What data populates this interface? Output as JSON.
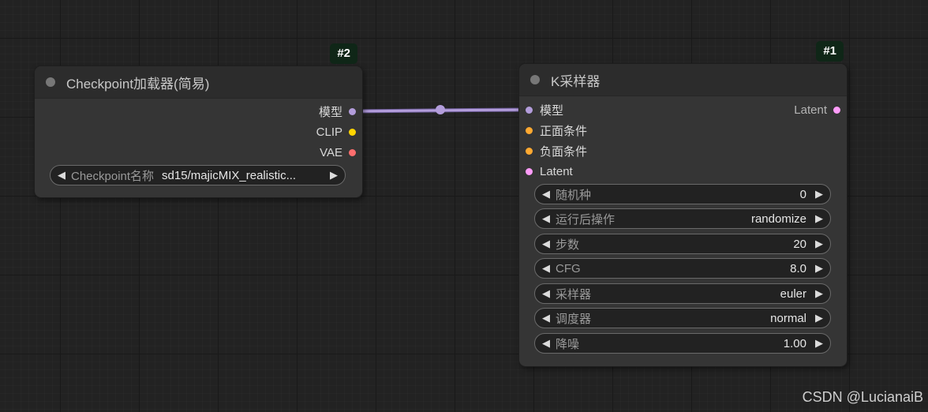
{
  "colors": {
    "model": "#b39ddb",
    "clip": "#ffd500",
    "vae": "#ff6e6e",
    "conditioning": "#ffa931",
    "latent": "#ff9cf9",
    "link_model": "#b39ddb",
    "badge_bg": "#0f2617"
  },
  "checkpoint_node": {
    "id_badge": "#2",
    "title": "Checkpoint加载器(简易)",
    "outputs": [
      {
        "label": "模型",
        "type": "model"
      },
      {
        "label": "CLIP",
        "type": "clip"
      },
      {
        "label": "VAE",
        "type": "vae"
      }
    ],
    "widget": {
      "label": "Checkpoint名称",
      "value": "sd15/majicMIX_realistic..."
    }
  },
  "ksampler_node": {
    "id_badge": "#1",
    "title": "K采样器",
    "inputs": [
      {
        "label": "模型",
        "type": "model"
      },
      {
        "label": "正面条件",
        "type": "conditioning"
      },
      {
        "label": "负面条件",
        "type": "conditioning"
      },
      {
        "label": "Latent",
        "type": "latent"
      }
    ],
    "outputs": [
      {
        "label": "Latent",
        "type": "latent"
      }
    ],
    "widgets": [
      {
        "label": "随机种",
        "value": "0"
      },
      {
        "label": "运行后操作",
        "value": "randomize"
      },
      {
        "label": "步数",
        "value": "20"
      },
      {
        "label": "CFG",
        "value": "8.0"
      },
      {
        "label": "采样器",
        "value": "euler"
      },
      {
        "label": "调度器",
        "value": "normal"
      },
      {
        "label": "降噪",
        "value": "1.00"
      }
    ]
  },
  "widget_arrows": {
    "left": "◀",
    "right": "▶"
  },
  "watermark": "CSDN @LucianaiB"
}
